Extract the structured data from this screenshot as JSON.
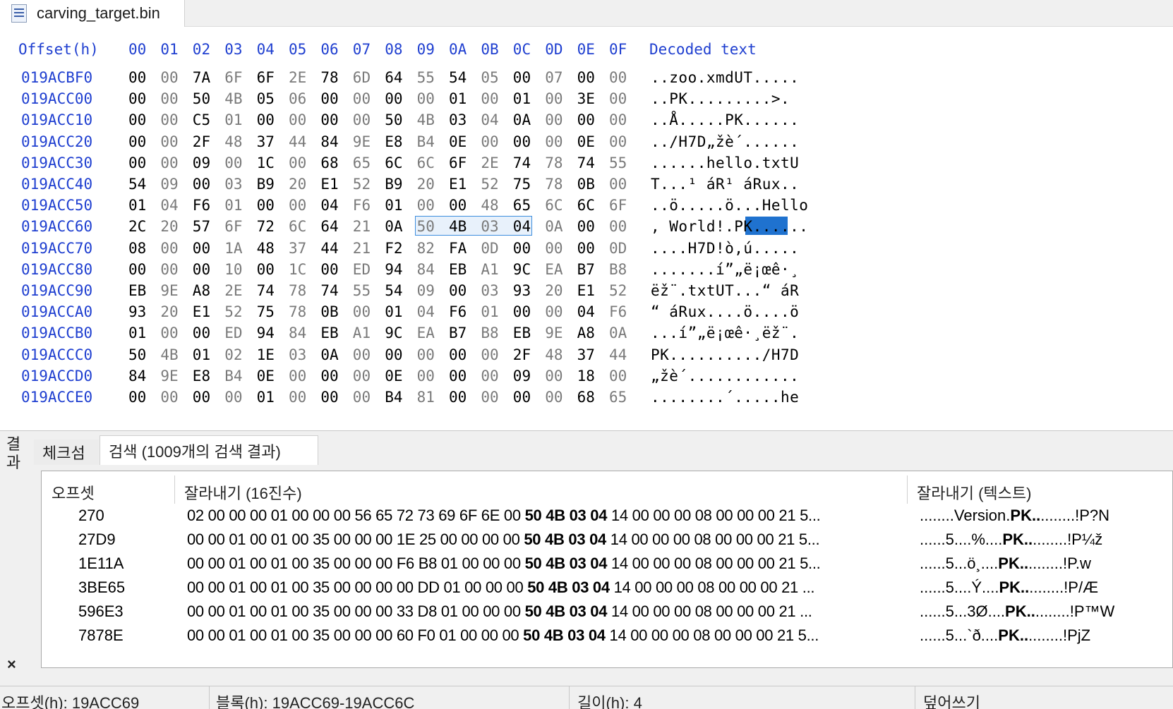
{
  "tab": {
    "title": "carving_target.bin",
    "icon": "hex-file-icon"
  },
  "hex_header": {
    "offset_label": "Offset(h)",
    "columns": [
      "00",
      "01",
      "02",
      "03",
      "04",
      "05",
      "06",
      "07",
      "08",
      "09",
      "0A",
      "0B",
      "0C",
      "0D",
      "0E",
      "0F"
    ],
    "text_label": "Decoded text"
  },
  "hex_rows": [
    {
      "offset": "019ACBF0",
      "bytes": [
        "00",
        "00",
        "7A",
        "6F",
        "6F",
        "2E",
        "78",
        "6D",
        "64",
        "55",
        "54",
        "05",
        "00",
        "07",
        "00",
        "00"
      ],
      "text": "..zoo.xmdUT....."
    },
    {
      "offset": "019ACC00",
      "bytes": [
        "00",
        "00",
        "50",
        "4B",
        "05",
        "06",
        "00",
        "00",
        "00",
        "00",
        "01",
        "00",
        "01",
        "00",
        "3E",
        "00"
      ],
      "text": "..PK.........>."
    },
    {
      "offset": "019ACC10",
      "bytes": [
        "00",
        "00",
        "C5",
        "01",
        "00",
        "00",
        "00",
        "00",
        "50",
        "4B",
        "03",
        "04",
        "0A",
        "00",
        "00",
        "00"
      ],
      "text": "..Å.....PK......"
    },
    {
      "offset": "019ACC20",
      "bytes": [
        "00",
        "00",
        "2F",
        "48",
        "37",
        "44",
        "84",
        "9E",
        "E8",
        "B4",
        "0E",
        "00",
        "00",
        "00",
        "0E",
        "00"
      ],
      "text": "../H7D„žè´......"
    },
    {
      "offset": "019ACC30",
      "bytes": [
        "00",
        "00",
        "09",
        "00",
        "1C",
        "00",
        "68",
        "65",
        "6C",
        "6C",
        "6F",
        "2E",
        "74",
        "78",
        "74",
        "55"
      ],
      "text": "......hello.txtU"
    },
    {
      "offset": "019ACC40",
      "bytes": [
        "54",
        "09",
        "00",
        "03",
        "B9",
        "20",
        "E1",
        "52",
        "B9",
        "20",
        "E1",
        "52",
        "75",
        "78",
        "0B",
        "00"
      ],
      "text": "T...¹ áR¹ áRux.."
    },
    {
      "offset": "019ACC50",
      "bytes": [
        "01",
        "04",
        "F6",
        "01",
        "00",
        "00",
        "04",
        "F6",
        "01",
        "00",
        "00",
        "48",
        "65",
        "6C",
        "6C",
        "6F"
      ],
      "text": "..ö.....ö...Hello"
    },
    {
      "offset": "019ACC60",
      "bytes": [
        "2C",
        "20",
        "57",
        "6F",
        "72",
        "6C",
        "64",
        "21",
        "0A",
        "50",
        "4B",
        "03",
        "04",
        "0A",
        "00",
        "00"
      ],
      "text": ", World!.PK......"
    },
    {
      "offset": "019ACC70",
      "bytes": [
        "08",
        "00",
        "00",
        "1A",
        "48",
        "37",
        "44",
        "21",
        "F2",
        "82",
        "FA",
        "0D",
        "00",
        "00",
        "00",
        "0D"
      ],
      "text": "....H7D!ò‚ú....."
    },
    {
      "offset": "019ACC80",
      "bytes": [
        "00",
        "00",
        "00",
        "10",
        "00",
        "1C",
        "00",
        "ED",
        "94",
        "84",
        "EB",
        "A1",
        "9C",
        "EA",
        "B7",
        "B8"
      ],
      "text": ".......í”„ë¡œê·¸"
    },
    {
      "offset": "019ACC90",
      "bytes": [
        "EB",
        "9E",
        "A8",
        "2E",
        "74",
        "78",
        "74",
        "55",
        "54",
        "09",
        "00",
        "03",
        "93",
        "20",
        "E1",
        "52"
      ],
      "text": "ëž¨.txtUT...“ áR"
    },
    {
      "offset": "019ACCA0",
      "bytes": [
        "93",
        "20",
        "E1",
        "52",
        "75",
        "78",
        "0B",
        "00",
        "01",
        "04",
        "F6",
        "01",
        "00",
        "00",
        "04",
        "F6"
      ],
      "text": "“ áRux....ö....ö"
    },
    {
      "offset": "019ACCB0",
      "bytes": [
        "01",
        "00",
        "00",
        "ED",
        "94",
        "84",
        "EB",
        "A1",
        "9C",
        "EA",
        "B7",
        "B8",
        "EB",
        "9E",
        "A8",
        "0A"
      ],
      "text": "...í”„ë¡œê·¸ëž¨."
    },
    {
      "offset": "019ACCC0",
      "bytes": [
        "50",
        "4B",
        "01",
        "02",
        "1E",
        "03",
        "0A",
        "00",
        "00",
        "00",
        "00",
        "00",
        "2F",
        "48",
        "37",
        "44"
      ],
      "text": "PK........../H7D"
    },
    {
      "offset": "019ACCD0",
      "bytes": [
        "84",
        "9E",
        "E8",
        "B4",
        "0E",
        "00",
        "00",
        "00",
        "0E",
        "00",
        "00",
        "00",
        "09",
        "00",
        "18",
        "00"
      ],
      "text": "„žè´............"
    },
    {
      "offset": "019ACCE0",
      "bytes": [
        "00",
        "00",
        "00",
        "00",
        "01",
        "00",
        "00",
        "00",
        "B4",
        "81",
        "00",
        "00",
        "00",
        "00",
        "68",
        "65"
      ],
      "text": "........´.....he"
    }
  ],
  "results_panel": {
    "vertical_title": "결과",
    "close": "×",
    "tabs": [
      "체크섬",
      "검색 (1009개의 검색 결과)"
    ],
    "columns": [
      "오프셋",
      "잘라내기 (16진수)",
      "잘라내기 (텍스트)"
    ],
    "rows": [
      {
        "offset": "270",
        "hex_pre": "02 00 00 00 01 00 00 00 56 65 72 73 69 6F 6E 00 ",
        "hex_match": "50 4B 03 04",
        "hex_post": " 14 00 00 00 08 00 00 00 21 5...",
        "txt_pre": "........Version.",
        "txt_match": "PK..",
        "txt_post": "........!P?N"
      },
      {
        "offset": "27D9",
        "hex_pre": "00 00 01 00 01 00 35 00 00 00 1E 25 00 00 00 00 ",
        "hex_match": "50 4B 03 04",
        "hex_post": " 14 00 00 00 08 00 00 00 21 5...",
        "txt_pre": "......5....%....",
        "txt_match": "PK..",
        "txt_post": "........!P¼ž"
      },
      {
        "offset": "1E11A",
        "hex_pre": "00 00 01 00 01 00 35 00 00 00 F6 B8 01 00 00 00 ",
        "hex_match": "50 4B 03 04",
        "hex_post": " 14 00 00 00 08 00 00 00 21 5...",
        "txt_pre": "......5...ö¸....",
        "txt_match": "PK..",
        "txt_post": "........!P.w"
      },
      {
        "offset": "3BE65",
        "hex_pre": "00 00 01 00 01 00 35 00 00 00 00 DD 01 00 00 00 ",
        "hex_match": "50 4B 03 04",
        "hex_post": " 14 00 00 00 08 00 00 00 21 ...",
        "txt_pre": "......5....Ý....",
        "txt_match": "PK..",
        "txt_post": "........!P/Æ"
      },
      {
        "offset": "596E3",
        "hex_pre": "00 00 01 00 01 00 35 00 00 00 33 D8 01 00 00 00 ",
        "hex_match": "50 4B 03 04",
        "hex_post": " 14 00 00 00 08 00 00 00 21 ...",
        "txt_pre": "......5...3Ø....",
        "txt_match": "PK..",
        "txt_post": "........!P™W"
      },
      {
        "offset": "7878E",
        "hex_pre": "00 00 01 00 01 00 35 00 00 00 60 F0 01 00 00 00 ",
        "hex_match": "50 4B 03 04",
        "hex_post": " 14 00 00 00 08 00 00 00 21 5...",
        "txt_pre": "......5...`ð....",
        "txt_match": "PK..",
        "txt_post": "........!PjZ"
      }
    ]
  },
  "status": {
    "offset": "오프셋(h): 19ACC69",
    "block": "블록(h): 19ACC69-19ACC6C",
    "length": "길이(h): 4",
    "mode": "덮어쓰기"
  },
  "colors": {
    "offset_blue": "#1f3fd0",
    "selection": "#1f72cf",
    "selection_border": "#3e8ede"
  }
}
